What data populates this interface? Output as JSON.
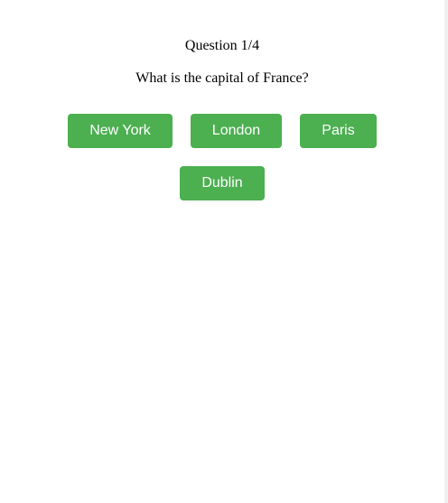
{
  "quiz": {
    "progress": "Question 1/4",
    "question": "What is the capital of France?",
    "answers": [
      {
        "label": "New York"
      },
      {
        "label": "London"
      },
      {
        "label": "Paris"
      },
      {
        "label": "Dublin"
      }
    ]
  },
  "colors": {
    "button_background": "#4caf50",
    "button_text": "#ffffff",
    "page_background": "#ffffff",
    "text": "#000000"
  }
}
